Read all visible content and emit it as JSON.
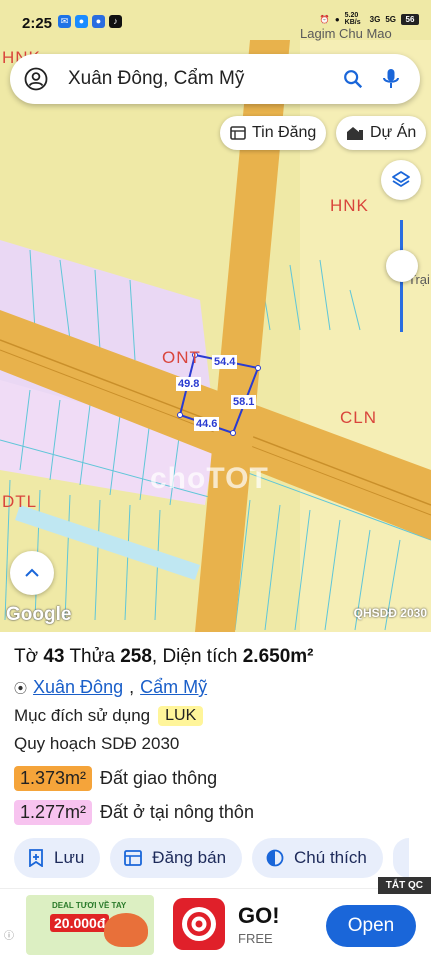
{
  "status_bar": {
    "time": "2:25",
    "network_speed": "5.20 KB/s",
    "signal_1": "3G",
    "signal_2": "5G",
    "battery": "56"
  },
  "search": {
    "query": "Xuân Đông, Cẩm Mỹ",
    "avatar_icon": "account-circle-icon",
    "search_icon": "search-icon",
    "mic_icon": "mic-icon"
  },
  "chips": {
    "listing_label": "Tin Đăng",
    "project_label": "Dự Án"
  },
  "map": {
    "place_top_right": "Lagim Chu Mao",
    "place_right_edge": "Trại",
    "zone_labels": {
      "hnk_top_left": "HNK",
      "hnk_right": "HNK",
      "ont": "ONT",
      "cln": "CLN",
      "dtl": "DTL"
    },
    "dimensions": {
      "top": "54.4",
      "left": "49.8",
      "right": "58.1",
      "bottom": "44.6"
    },
    "watermark": "choTOT",
    "attribution": "Google",
    "plan_badge": "QHSDĐ 2030"
  },
  "parcel": {
    "to_label": "Tờ",
    "to_value": "43",
    "thua_label": "Thửa",
    "thua_value": "258",
    "area_label": ", Diện tích",
    "area_value": "2.650m²",
    "commune": "Xuân Đông",
    "separator": ",",
    "district": "Cẩm Mỹ",
    "purpose_label": "Mục đích sử dụng",
    "purpose_code": "LUK",
    "planning_label": "Quy hoạch SDĐ 2030",
    "land_uses": [
      {
        "area": "1.373m²",
        "label": "Đất giao thông",
        "color": "#f5a43a"
      },
      {
        "area": "1.277m²",
        "label": "Đất ở tại nông thôn",
        "color": "#f7c3ef"
      }
    ]
  },
  "actions": [
    {
      "label": "Lưu",
      "icon": "bookmark-add-icon"
    },
    {
      "label": "Đăng bán",
      "icon": "listing-icon"
    },
    {
      "label": "Chú thích",
      "icon": "legend-icon"
    }
  ],
  "ad": {
    "close_tag": "TẮT QC",
    "banner_line1": "DEAL TƯƠI VỀ TAY",
    "banner_price": "20.000đ",
    "app_name": "GO!",
    "price": "FREE",
    "cta": "Open"
  },
  "colors": {
    "map_bg": "#efe9a6",
    "road": "#e8b24c",
    "ont_zone": "#ead8f4",
    "zone_text": "#d9453c",
    "parcel_outline": "#2a3bd1",
    "accent": "#1a66d9"
  }
}
